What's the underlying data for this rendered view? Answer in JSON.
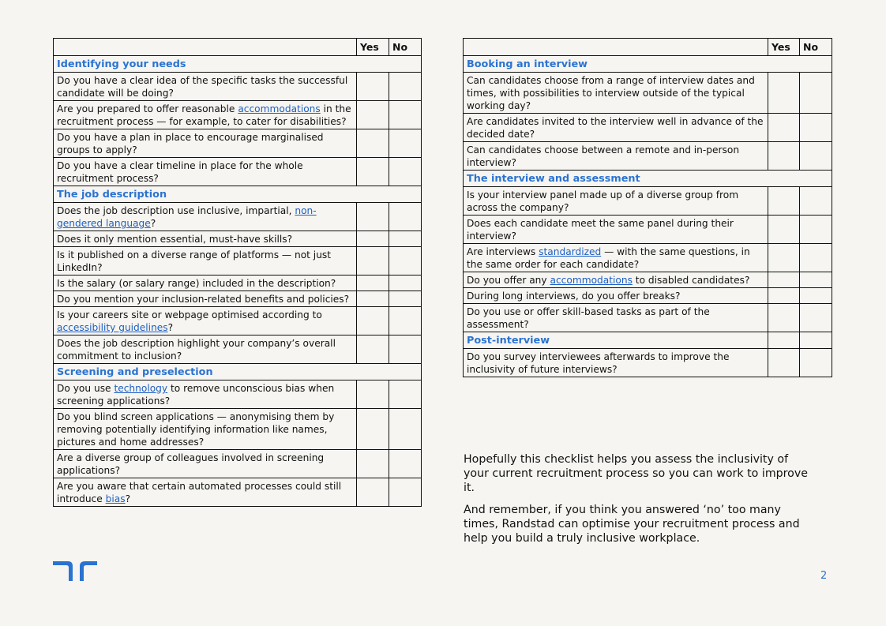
{
  "brand": {
    "accent_color": "#2b73d1",
    "link_color": "#1d5fc4",
    "logo_icon": "randstad-logo-icon"
  },
  "columns": {
    "yes": "Yes",
    "no": "No"
  },
  "left_table": {
    "sections": [
      {
        "title": "Identifying your needs",
        "items": [
          {
            "parts": [
              {
                "text": "Do you have a clear idea of the specific tasks the successful candidate will be doing?"
              }
            ]
          },
          {
            "parts": [
              {
                "text": "Are you prepared to offer reasonable "
              },
              {
                "text": "accommodations",
                "link": true
              },
              {
                "text": " in the recruitment process — for example, to cater for disabilities?"
              }
            ]
          },
          {
            "parts": [
              {
                "text": "Do you have a plan in place to encourage marginalised groups to apply?"
              }
            ]
          },
          {
            "parts": [
              {
                "text": "Do you have a clear timeline in place for the whole recruitment process?"
              }
            ]
          }
        ]
      },
      {
        "title": "The job description",
        "items": [
          {
            "parts": [
              {
                "text": "Does the job description use inclusive, impartial, "
              },
              {
                "text": "non-gendered language",
                "link": true
              },
              {
                "text": "?"
              }
            ]
          },
          {
            "parts": [
              {
                "text": "Does it only mention essential, must-have skills?"
              }
            ]
          },
          {
            "parts": [
              {
                "text": "Is it published on a diverse range of platforms — not just LinkedIn?"
              }
            ]
          },
          {
            "parts": [
              {
                "text": "Is the salary (or salary range) included in the description?"
              }
            ]
          },
          {
            "parts": [
              {
                "text": "Do you mention your inclusion-related benefits and policies?"
              }
            ]
          },
          {
            "parts": [
              {
                "text": "Is your careers site or webpage optimised according to "
              },
              {
                "text": "accessibility guidelines",
                "link": true
              },
              {
                "text": "?"
              }
            ]
          },
          {
            "parts": [
              {
                "text": "Does the job description highlight your company’s overall commitment to inclusion?"
              }
            ]
          }
        ]
      },
      {
        "title": "Screening and preselection",
        "items": [
          {
            "parts": [
              {
                "text": "Do you use "
              },
              {
                "text": "technology",
                "link": true
              },
              {
                "text": " to remove unconscious bias when screening applications?"
              }
            ]
          },
          {
            "parts": [
              {
                "text": "Do you blind screen applications — anonymising them by removing potentially identifying information like names, pictures and home addresses?"
              }
            ]
          },
          {
            "parts": [
              {
                "text": "Are a diverse group of colleagues involved in screening applications?"
              }
            ]
          },
          {
            "parts": [
              {
                "text": "Are you aware that certain automated processes could still introduce "
              },
              {
                "text": "bias",
                "link": true
              },
              {
                "text": "?"
              }
            ]
          }
        ]
      }
    ]
  },
  "right_table": {
    "sections": [
      {
        "title": "Booking an interview",
        "items": [
          {
            "parts": [
              {
                "text": "Can candidates choose from a range of interview dates and times, with possibilities to interview outside of the typical working day?"
              }
            ]
          },
          {
            "parts": [
              {
                "text": "Are candidates invited to the interview well in advance of the decided date?"
              }
            ]
          },
          {
            "parts": [
              {
                "text": "Can candidates choose between a remote and in-person interview?"
              }
            ]
          }
        ]
      },
      {
        "title": "The interview and assessment",
        "items": [
          {
            "parts": [
              {
                "text": "Is your interview panel made up of a diverse group from across the company?"
              }
            ]
          },
          {
            "parts": [
              {
                "text": "Does each candidate meet the same panel during their interview?"
              }
            ]
          },
          {
            "parts": [
              {
                "text": "Are interviews "
              },
              {
                "text": "standardized",
                "link": true
              },
              {
                "text": " — with the same questions, in the same order for each candidate?"
              }
            ],
            "tall": true
          },
          {
            "parts": [
              {
                "text": "Do you offer any "
              },
              {
                "text": "accommodations",
                "link": true
              },
              {
                "text": " to disabled candidates?"
              }
            ]
          },
          {
            "parts": [
              {
                "text": "During long interviews, do you offer breaks?"
              }
            ]
          },
          {
            "parts": [
              {
                "text": "Do you use or offer skill-based tasks as part of the assessment?"
              }
            ],
            "tall": true
          }
        ]
      },
      {
        "title": "Post-interview",
        "title_has_cells": true,
        "items": [
          {
            "parts": [
              {
                "text": "Do you survey interviewees afterwards to improve the inclusivity of future interviews?"
              }
            ]
          }
        ]
      }
    ]
  },
  "closing": {
    "paragraphs": [
      "Hopefully this checklist helps you assess the inclusivity of your current recruitment process so you can work to improve it.",
      "And remember, if you think you answered ‘no’ too many times, Randstad can optimise your recruitment process and help you build a truly inclusive workplace."
    ]
  },
  "page_number": "2"
}
